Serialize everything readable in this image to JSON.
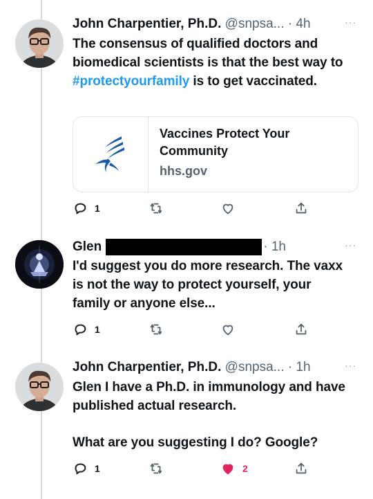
{
  "tweets": [
    {
      "name": "John Charpentier, Ph.D.",
      "handle": "@snpsa...",
      "time": "· 4h",
      "text_pre": "The consensus of qualified doctors and biomedical scientists is that the best way to ",
      "hashtag": "#protectyourfamily",
      "text_post": " is to get vaccinated.",
      "card": {
        "title": "Vaccines Protect Your Community",
        "domain": "hhs.gov"
      },
      "actions": {
        "reply_count": "1",
        "retweet_count": "",
        "like_count": ""
      }
    },
    {
      "name": "Glen",
      "time": "· 1h",
      "text": "I'd suggest you do more research. The vaxx is not the way to protect yourself, your family or anyone else...",
      "actions": {
        "reply_count": "1",
        "retweet_count": "",
        "like_count": ""
      }
    },
    {
      "name": "John Charpentier, Ph.D.",
      "handle": "@snpsa...",
      "time": "· 1h",
      "text_line1": "Glen I have a Ph.D. in immunology and have published actual research.",
      "text_line2": "What are you suggesting I do? Google?",
      "actions": {
        "reply_count": "1",
        "retweet_count": "",
        "like_count": "2",
        "liked": true
      }
    }
  ],
  "more_label": "···",
  "colors": {
    "like_active": "#e0245e",
    "link": "#1d9bf0",
    "icon": "#536471"
  },
  "icons": [
    "reply-icon",
    "retweet-icon",
    "like-icon",
    "share-icon",
    "hhs-eagle-icon",
    "more-icon"
  ]
}
